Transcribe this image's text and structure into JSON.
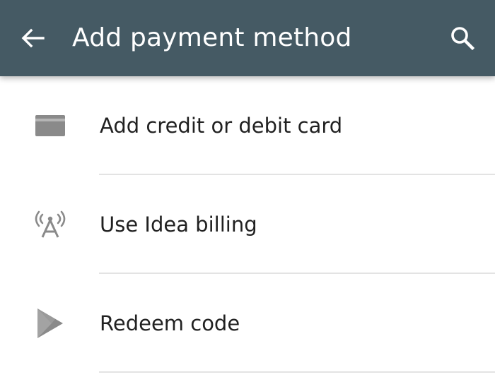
{
  "appbar": {
    "back_icon": "arrow-back-icon",
    "title": "Add payment method",
    "search_icon": "search-icon",
    "background": "#455a64"
  },
  "payment_options": [
    {
      "icon": "credit-card-icon",
      "label": "Add credit or debit card"
    },
    {
      "icon": "carrier-billing-icon",
      "label": "Use Idea billing"
    },
    {
      "icon": "play-store-icon",
      "label": "Redeem code"
    }
  ]
}
